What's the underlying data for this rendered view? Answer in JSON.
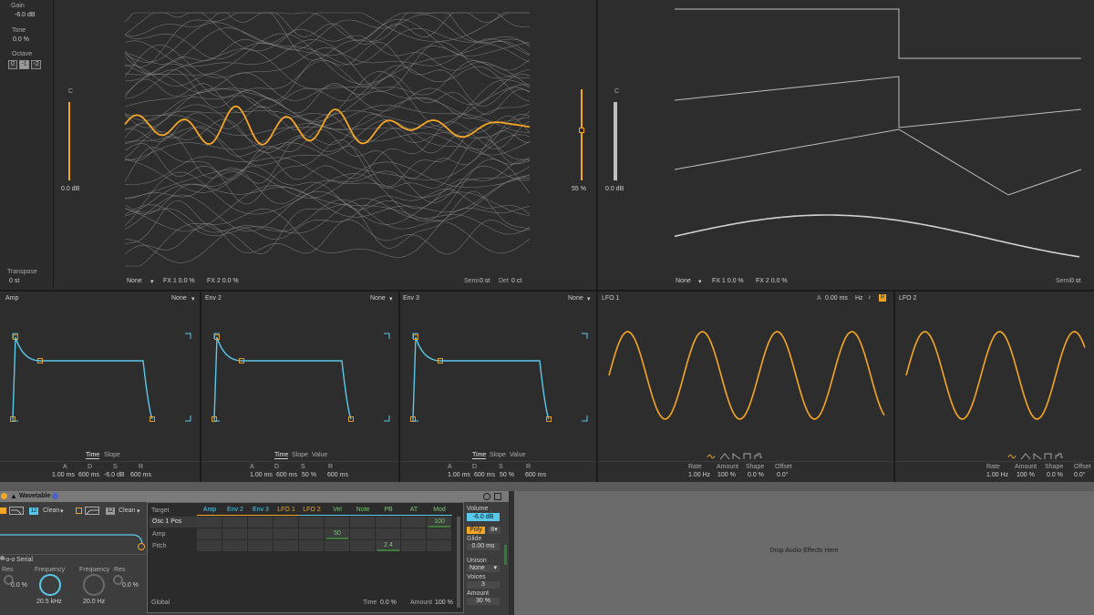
{
  "osc1": {
    "gain_label": "Gain",
    "gain_value": "-6.0 dB",
    "tone_label": "Tone",
    "tone_value": "0.0 %",
    "octave_label": "Octave",
    "octave_options": [
      "0",
      "-1",
      "-2"
    ],
    "transpose_label": "Transpose",
    "transpose_value": "0 st",
    "note_left": "C",
    "level_left": "0.0 dB",
    "position_value": "55 %",
    "fx_select": "None",
    "fx1": "FX 1 0.0 %",
    "fx2": "FX 2 0.0 %",
    "semi_label": "Semi",
    "semi_value": "0 st",
    "det_label": "Det",
    "det_value": "0 ct"
  },
  "osc2": {
    "note": "C",
    "level": "0.0 dB",
    "fx_select": "None",
    "fx1": "FX 1 0.0 %",
    "fx2": "FX 2 0.0 %",
    "semi_label": "Semi",
    "semi_value": "0 st"
  },
  "envelopes": [
    {
      "title": "Amp",
      "target": "None",
      "tabs": [
        "Time",
        "Slope"
      ],
      "labels": [
        "A",
        "D",
        "S",
        "R"
      ],
      "values": [
        "1.00 ms",
        "600 ms",
        "-6.0 dB",
        "600 ms"
      ]
    },
    {
      "title": "Env 2",
      "target": "None",
      "tabs": [
        "Time",
        "Slope",
        "Value"
      ],
      "labels": [
        "A",
        "D",
        "S",
        "R"
      ],
      "values": [
        "1.00 ms",
        "600 ms",
        "50 %",
        "600 ms"
      ]
    },
    {
      "title": "Env 3",
      "target": "None",
      "tabs": [
        "Time",
        "Slope",
        "Value"
      ],
      "labels": [
        "A",
        "D",
        "S",
        "R"
      ],
      "values": [
        "1.00 ms",
        "600 ms",
        "50 %",
        "600 ms"
      ]
    }
  ],
  "lfos": [
    {
      "title": "LFO 1",
      "attack_label": "A",
      "attack_value": "0.00 ms",
      "unit": "Hz",
      "labels": [
        "Rate",
        "Amount",
        "Shape",
        "Offset"
      ],
      "values": [
        "1.00 Hz",
        "100 %",
        "0.0 %",
        "0.0°"
      ]
    },
    {
      "title": "LFO 2",
      "labels": [
        "Rate",
        "Amount",
        "Shape",
        "Offset"
      ],
      "values": [
        "1.00 Hz",
        "100 %",
        "0.0 %",
        "0.0°"
      ]
    }
  ],
  "device": {
    "title": "Wavetable",
    "filter_slope": "12",
    "filter_mode": "Clean",
    "filter2_slope": "12",
    "filter2_mode": "Clean",
    "routing": "Serial",
    "res_label": "Res",
    "res_value": "0.0 %",
    "freq_label": "Frequency",
    "freq_value": "20.5 kHz",
    "freq2_label": "Frequency",
    "freq2_value": "20.0 Hz",
    "res2_label": "Res",
    "res2_value": "0.0 %"
  },
  "matrix": {
    "target_header": "Target",
    "columns": [
      "Amp",
      "Env 2",
      "Env 3",
      "LFO 1",
      "LFO 2",
      "Vel",
      "Note",
      "PB",
      "AT",
      "Mod"
    ],
    "rows": [
      "Osc 1 Pos",
      "Amp",
      "Pitch"
    ],
    "cell_values": [
      {
        "row": 0,
        "col": 9,
        "text": "100"
      },
      {
        "row": 1,
        "col": 5,
        "text": "50"
      },
      {
        "row": 2,
        "col": 7,
        "text": "2.4"
      }
    ],
    "global_label": "Global",
    "time_label": "Time",
    "time_value": "0.0 %",
    "amount_label": "Amount",
    "amount_value": "100 %"
  },
  "global": {
    "volume_label": "Volume",
    "volume_value": "-6.0 dB",
    "poly_label": "Poly",
    "poly_voices": "8",
    "glide_label": "Glide",
    "glide_value": "0.00 ms",
    "unison_label": "Unison",
    "unison_value": "None",
    "voices_label": "Voices",
    "voices_value": "3",
    "amount_label": "Amount",
    "amount_value": "30 %"
  },
  "drop_zone": "Drop Audio Effects Here",
  "colors": {
    "accent": "#f5a623",
    "env": "#5ac8e8",
    "bg": "#2d2d2d"
  }
}
